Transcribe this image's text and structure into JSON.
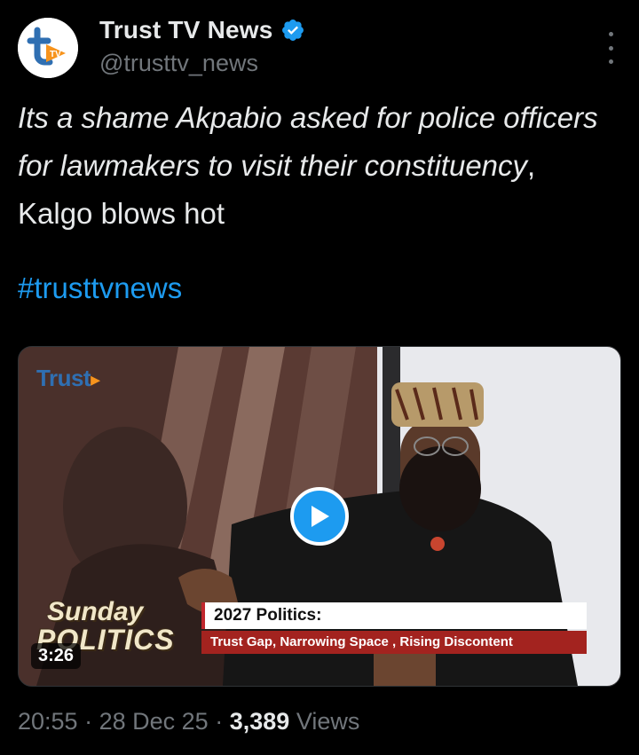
{
  "account": {
    "name": "Trust TV News",
    "handle": "@trusttv_news",
    "avatar_text": "TV",
    "verified": true
  },
  "tweet": {
    "text_italic": "Its a shame Akpabio asked for police officers for lawmakers to visit their constituency",
    "text_regular": ", Kalgo blows hot",
    "hashtag": "#trusttvnews"
  },
  "video": {
    "brand": "Trust",
    "show_line1": "Sunday",
    "show_line2": "POLITICS",
    "lower_third_title": "2027 Politics:",
    "lower_third_subtitle": "Trust Gap, Narrowing Space , Rising Discontent",
    "duration": "3:26"
  },
  "meta": {
    "time": "20:55",
    "date": "28 Dec 25",
    "views_count": "3,389",
    "views_label": "Views"
  },
  "colors": {
    "accent": "#1d9bf0",
    "background": "#000000",
    "secondary_text": "#71767b"
  },
  "icons": [
    "verified-badge-icon",
    "more-options-icon",
    "play-icon"
  ]
}
